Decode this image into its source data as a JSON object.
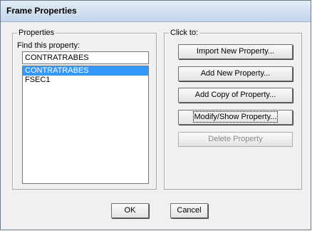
{
  "window": {
    "title": "Frame Properties"
  },
  "properties": {
    "group_label": "Properties",
    "find_label": "Find this property:",
    "search_value": "CONTRATRABES",
    "items": [
      {
        "label": "CONTRATRABES",
        "selected": true
      },
      {
        "label": "FSEC1",
        "selected": false
      }
    ]
  },
  "actions": {
    "group_label": "Click to:",
    "import_label": "Import New Property...",
    "add_label": "Add New Property...",
    "copy_label": "Add Copy of Property...",
    "modify_label": "Modify/Show Property...",
    "delete_label": "Delete Property"
  },
  "footer": {
    "ok_label": "OK",
    "cancel_label": "Cancel"
  }
}
